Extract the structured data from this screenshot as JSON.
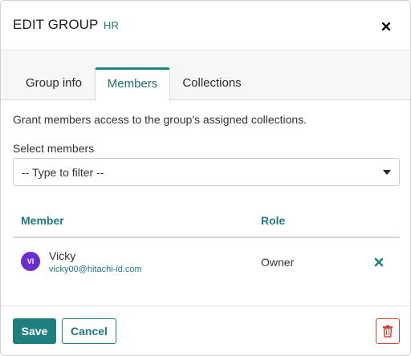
{
  "header": {
    "title": "EDIT GROUP",
    "subtitle": "HR",
    "close_icon": "close-icon"
  },
  "tabs": [
    {
      "label": "Group info",
      "active": false
    },
    {
      "label": "Members",
      "active": true
    },
    {
      "label": "Collections",
      "active": false
    }
  ],
  "members_tab": {
    "description": "Grant members access to the group's assigned collections.",
    "select_label": "Select members",
    "select_placeholder": "-- Type to filter --",
    "table": {
      "columns": [
        "Member",
        "Role"
      ],
      "rows": [
        {
          "avatar_initials": "VI",
          "name": "Vicky",
          "email": "vicky00@hitachi-id.com",
          "role": "Owner",
          "remove_icon": "remove-icon"
        }
      ]
    }
  },
  "footer": {
    "save_label": "Save",
    "cancel_label": "Cancel",
    "delete_icon": "trash-icon"
  },
  "colors": {
    "accent": "#1f7f7f",
    "avatar": "#6b2fcf",
    "danger": "#c9453a"
  }
}
